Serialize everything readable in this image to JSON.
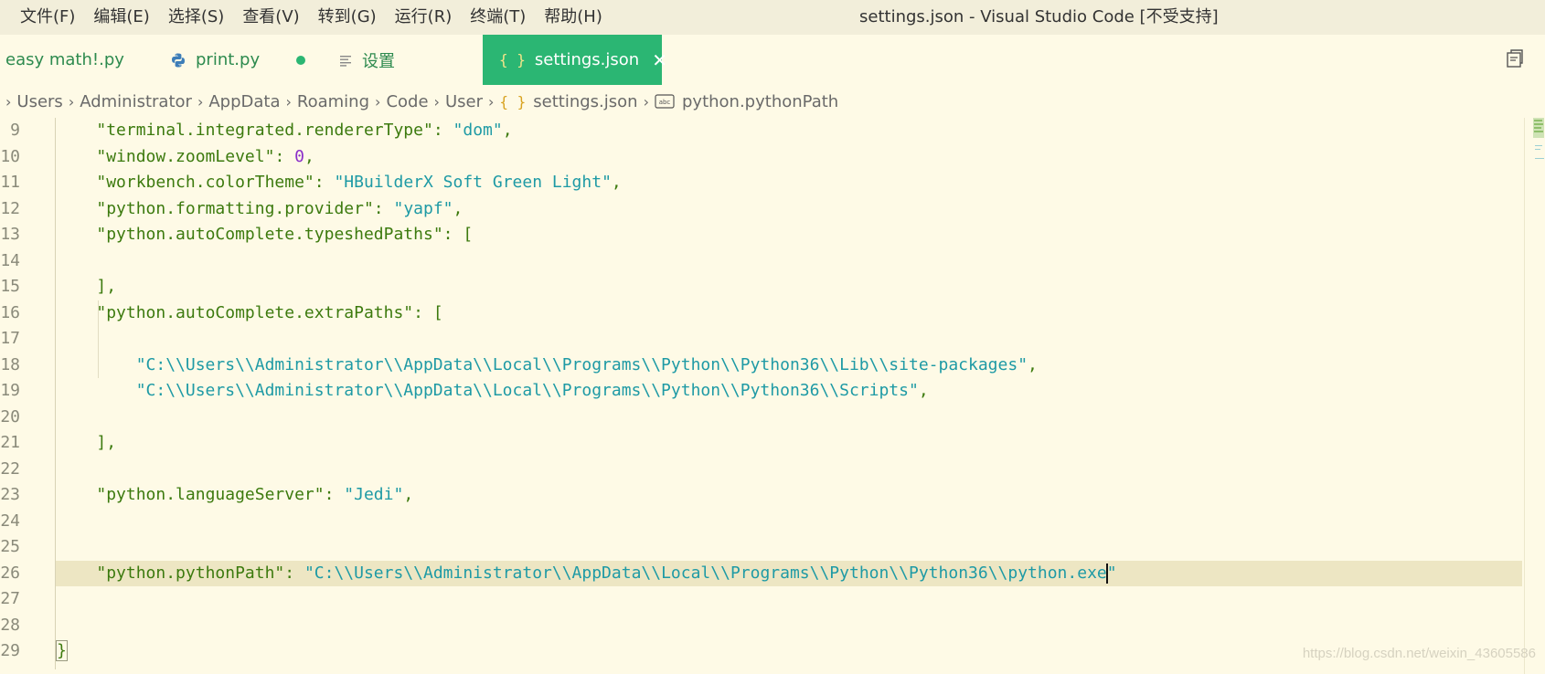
{
  "menu": {
    "items": [
      "文件(F)",
      "编辑(E)",
      "选择(S)",
      "查看(V)",
      "转到(G)",
      "运行(R)",
      "终端(T)",
      "帮助(H)"
    ]
  },
  "window": {
    "title": "settings.json - Visual Studio Code [不受支持]"
  },
  "tabs": [
    {
      "label": "easy math!.py",
      "icon": "none"
    },
    {
      "label": "print.py",
      "icon": "python-icon",
      "dirty": true
    },
    {
      "label": "设置",
      "icon": "lines-icon"
    },
    {
      "label": "settings.json",
      "icon": "json-braces-icon",
      "active": true,
      "close": "✕"
    }
  ],
  "breadcrumb": {
    "items": [
      "Users",
      "Administrator",
      "AppData",
      "Roaming",
      "Code",
      "User",
      "settings.json",
      "python.pythonPath"
    ],
    "json_icon": "{ }",
    "string_icon": "abc"
  },
  "editor": {
    "cursor_line": "26",
    "lines": [
      {
        "n": "9"
      },
      {
        "n": "10"
      },
      {
        "n": "11"
      },
      {
        "n": "12"
      },
      {
        "n": "13"
      },
      {
        "n": "14"
      },
      {
        "n": "15"
      },
      {
        "n": "16"
      },
      {
        "n": "17"
      },
      {
        "n": "18"
      },
      {
        "n": "19"
      },
      {
        "n": "20"
      },
      {
        "n": "21"
      },
      {
        "n": "22"
      },
      {
        "n": "23"
      },
      {
        "n": "24"
      },
      {
        "n": "25"
      },
      {
        "n": "26"
      },
      {
        "n": "27"
      },
      {
        "n": "28"
      },
      {
        "n": "29"
      }
    ],
    "tokens": {
      "l9_key": "\"terminal.integrated.rendererType\"",
      "l9_val": "\"dom\"",
      "l10_key": "\"window.zoomLevel\"",
      "l10_val": "0",
      "l11_key": "\"workbench.colorTheme\"",
      "l11_val": "\"HBuilderX Soft Green Light\"",
      "l12_key": "\"python.formatting.provider\"",
      "l12_val": "\"yapf\"",
      "l13_key": "\"python.autoComplete.typeshedPaths\"",
      "l13_open": "[",
      "l15_close": "],",
      "l16_key": "\"python.autoComplete.extraPaths\"",
      "l16_open": "[",
      "l18_val": "\"C:\\\\Users\\\\Administrator\\\\AppData\\\\Local\\\\Programs\\\\Python\\\\Python36\\\\Lib\\\\site-packages\"",
      "l19_val": "\"C:\\\\Users\\\\Administrator\\\\AppData\\\\Local\\\\Programs\\\\Python\\\\Python36\\\\Scripts\"",
      "l21_close": "],",
      "l23_key": "\"python.languageServer\"",
      "l23_val": "\"Jedi\"",
      "l26_key": "\"python.pythonPath\"",
      "l26_val_a": "\"C:\\\\Users\\\\Administrator\\\\AppData\\\\Local\\\\Programs\\\\Python\\\\Python36\\\\python.exe",
      "l26_val_b": "\"",
      "l29_brace": "}"
    }
  },
  "watermark": "https://blog.csdn.net/weixin_43605586",
  "colors": {
    "background": "#FEFAE6",
    "titlebar": "#F2EEDA",
    "active_tab": "#2BB673",
    "tab_text": "#2d8a4e",
    "key": "#3c7a0e",
    "string": "#1e9aa5",
    "number": "#8b2fc9",
    "current_line": "#EDE6C3"
  }
}
